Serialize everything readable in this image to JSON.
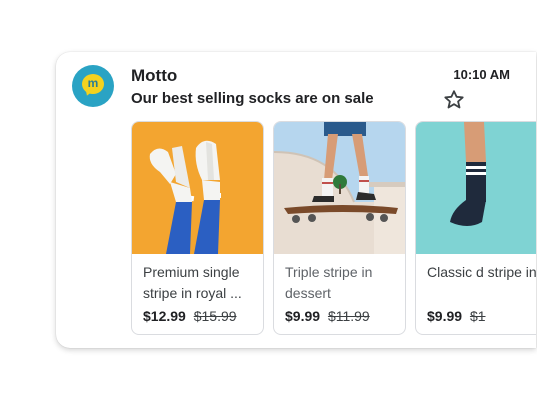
{
  "email": {
    "sender": "Motto",
    "avatar_letter": "m",
    "time": "10:10 AM",
    "subject": "Our best selling socks are on sale",
    "star_icon": "star-outline-icon"
  },
  "products": [
    {
      "title": "Premium single stripe in royal ...",
      "price": "$12.99",
      "original_price": "$15.99",
      "image": "orange-background-legs-blue-socks"
    },
    {
      "title": "Triple stripe in dessert",
      "price": "$9.99",
      "original_price": "$11.99",
      "image": "skateboarder-in-skatepark"
    },
    {
      "title": "Classic d stripe in",
      "price": "$9.99",
      "original_price": "$1",
      "image": "teal-background-dark-socks"
    }
  ],
  "colors": {
    "avatar_bg": "#2aa3c4",
    "avatar_bubble": "#f4d21f",
    "orange_bg": "#f3a530",
    "teal_bg": "#7fd3d3"
  }
}
